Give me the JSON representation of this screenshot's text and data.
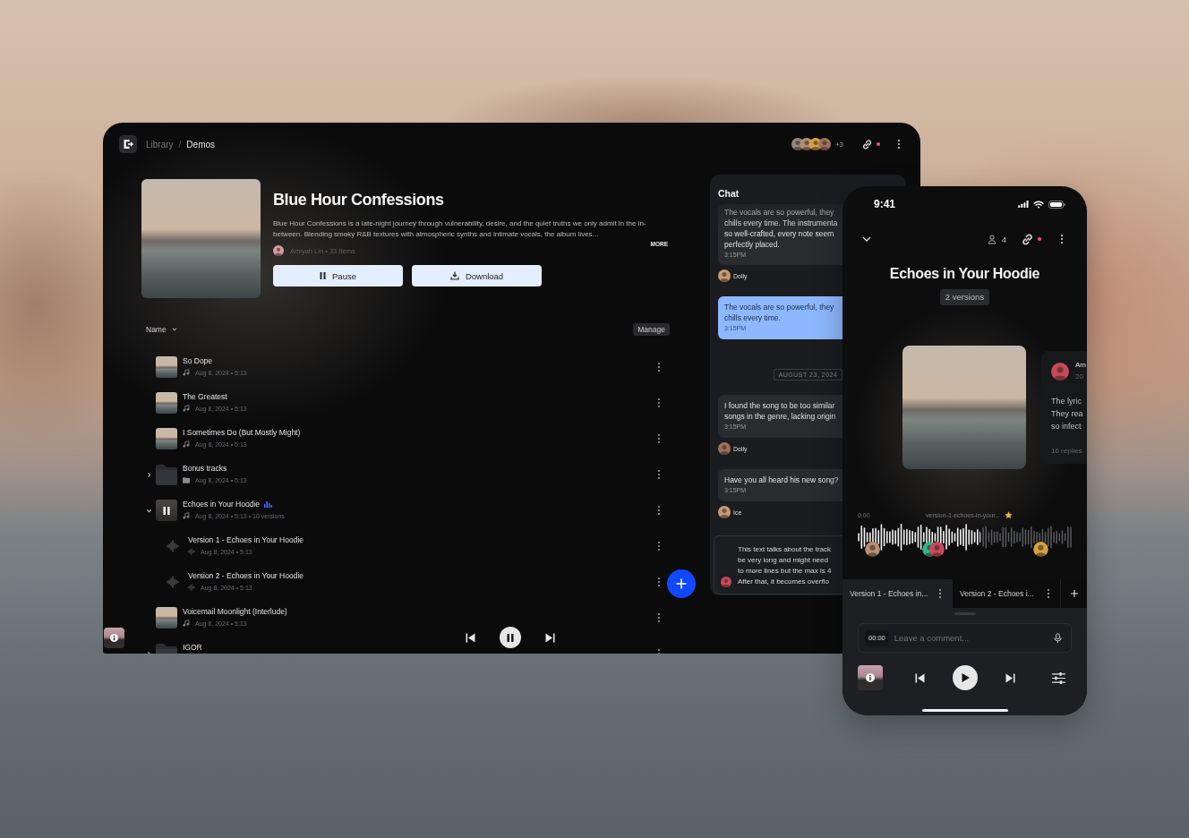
{
  "desktop": {
    "breadcrumb": [
      {
        "label": "Library",
        "selected": false
      },
      {
        "label": "Demos",
        "selected": true
      }
    ],
    "breadcrumb_separator": "/",
    "collaborators_more": "+3",
    "share_alert": true,
    "album": {
      "title": "Blue Hour Confessions",
      "description": "Blue Hour Confessions is a late-night journey through vulnerability, desire, and the quiet truths we only admit in the in-between. Blending smoky R&B textures with atmospheric synths and intimate vocals, the album lives...",
      "more": "MORE",
      "byline": "Amiyah Lin • 33 Items"
    },
    "actions": [
      {
        "kind": "pause",
        "label": "Pause"
      },
      {
        "kind": "download",
        "label": "Download"
      }
    ],
    "sort": "Name",
    "manage": "Manage",
    "tracks": [
      {
        "kind": "track",
        "title": "So Dope",
        "meta": "Aug 8, 2024 • 5:13",
        "playing": false
      },
      {
        "kind": "track",
        "title": "The Greatest",
        "meta": "Aug 8, 2024 • 5:13",
        "playing": false
      },
      {
        "kind": "track",
        "title": "I Sometimes Do (But Mostly Might)",
        "meta": "Aug 8, 2024 • 5:13",
        "playing": false
      },
      {
        "kind": "folder",
        "title": "Bonus tracks",
        "meta": "Aug 8, 2024 • 5:13",
        "expanded": false
      },
      {
        "kind": "track",
        "title": "Echoes in Your Hoodie",
        "meta": "Aug 8, 2024 • 5:13 • 10 versions",
        "playing": true,
        "expanded": true,
        "children": [
          {
            "kind": "version",
            "title": "Version 1 - Echoes in Your Hoodie",
            "meta": "Aug 8, 2024 • 5:13"
          },
          {
            "kind": "version",
            "title": "Version 2 - Echoes in Your Hoodie",
            "meta": "Aug 8, 2024 • 5:13"
          }
        ]
      },
      {
        "kind": "track",
        "title": "Voicemail Moonlight (Interlude)",
        "meta": "Aug 8, 2024 • 5:13",
        "playing": false
      },
      {
        "kind": "folder",
        "title": "IGOR",
        "expanded": false
      }
    ],
    "player": {
      "playing": true
    },
    "chat": {
      "title": "Chat",
      "messages": [
        {
          "kind": "received",
          "text": "The vocals are so powerful, they\nchills every time. The instrumenta\nso well-crafted, every note seem\nperfectly placed.",
          "time": "3:15PM",
          "author": "Dolly"
        },
        {
          "kind": "sent",
          "text": "The vocals are so powerful, they\nchills every time.",
          "time": "3:15PM"
        },
        {
          "kind": "date",
          "text": "AUGUST 23, 2024"
        },
        {
          "kind": "received",
          "text": "I found the song to be too similar\nsongs in the genre, lacking origin",
          "time": "3:15PM",
          "author": "Dolly"
        },
        {
          "kind": "received",
          "text": "Have you all heard his new song?",
          "time": "3:15PM",
          "author": "Ice"
        }
      ],
      "comment": "This text talks about the track\nbe very long and might need\nto more lines but the max is 4\nAfter that, it becomes overflo"
    }
  },
  "phone": {
    "time": "9:41",
    "listeners": "4",
    "share_alert": true,
    "title": "Echoes in Your Hoodie",
    "versions": "2 versions",
    "comment": {
      "author": "Am",
      "age": "20",
      "text": "The lyric\nThey rea\nso infect",
      "replies": "16 replies"
    },
    "waveform": {
      "start": "0:00",
      "file": "version-1-echoes-in-your...",
      "starred": true,
      "level": 0.57
    },
    "tabs": [
      {
        "label": "Version 1 - Echoes in...",
        "selected": true
      },
      {
        "label": "Version 2 - Echoes i...",
        "selected": false
      }
    ],
    "comment_field": {
      "time": "00:00",
      "placeholder": "Leave a comment..."
    },
    "playing": false
  }
}
